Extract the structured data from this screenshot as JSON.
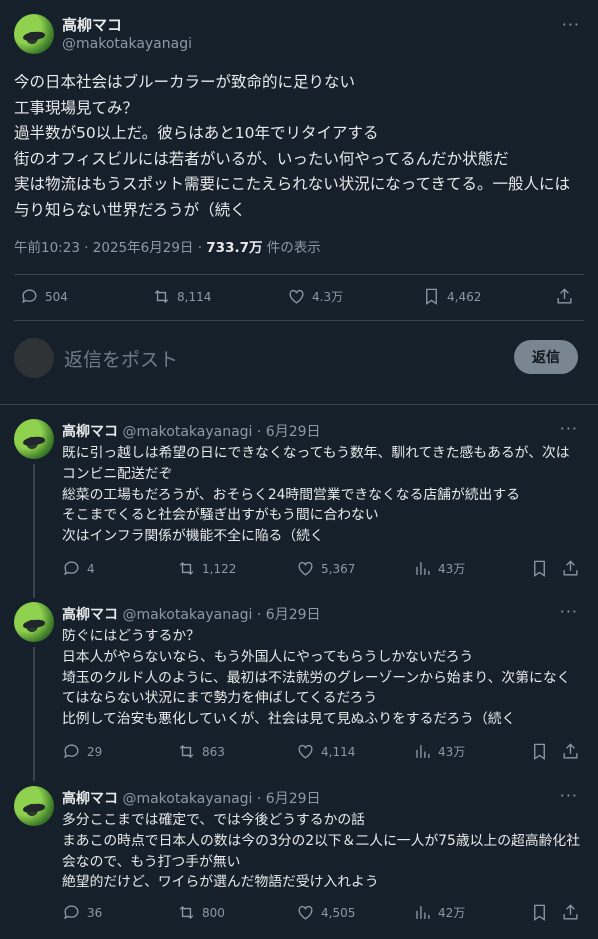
{
  "main_tweet": {
    "name": "高柳マコ",
    "handle": "@makotakayanagi",
    "body": "今の日本社会はブルーカラーが致命的に足りない\n工事現場見てみ？\n過半数が50以上だ。彼らはあと10年でリタイアする\n街のオフィスビルには若者がいるが、いったい何やってるんだか状態だ\n実は物流はもうスポット需要にこたえられない状況になってきてる。一般人には与り知らない世界だろうが（続く",
    "timestamp": "午前10:23 · 2025年6月29日 · ",
    "views_count": "733.7万",
    "views_label": " 件の表示",
    "replies": "504",
    "retweets": "8,114",
    "likes": "4.3万",
    "bookmarks": "4,462"
  },
  "reply_box": {
    "placeholder": "返信をポスト",
    "button_label": "返信"
  },
  "replies": [
    {
      "name": "高柳マコ",
      "meta": "@makotakayanagi · 6月29日",
      "body": "既に引っ越しは希望の日にできなくなってもう数年、馴れてきた感もあるが、次はコンビニ配送だぞ\n総菜の工場もだろうが、おそらく24時間営業できなくなる店舗が続出する\nそこまでくると社会が騒ぎ出すがもう間に合わない\n次はインフラ関係が機能不全に陥る（続く",
      "replies": "4",
      "retweets": "1,122",
      "likes": "5,367",
      "views": "43万"
    },
    {
      "name": "高柳マコ",
      "meta": "@makotakayanagi · 6月29日",
      "body": "防ぐにはどうするか？\n日本人がやらないなら、もう外国人にやってもらうしかないだろう\n埼玉のクルド人のように、最初は不法就労のグレーゾーンから始まり、次第になくてはならない状況にまで勢力を伸ばしてくるだろう\n比例して治安も悪化していくが、社会は見て見ぬふりをするだろう（続く",
      "replies": "29",
      "retweets": "863",
      "likes": "4,114",
      "views": "43万"
    },
    {
      "name": "高柳マコ",
      "meta": "@makotakayanagi · 6月29日",
      "body": "多分ここまでは確定で、では今後どうするかの話\nまあこの時点で日本人の数は今の3分の2以下＆二人に一人が75歳以上の超高齢化社会なので、もう打つ手が無い\n絶望的だけど、ワイらが選んだ物語だ受け入れよう",
      "replies": "36",
      "retweets": "800",
      "likes": "4,505",
      "views": "42万"
    }
  ],
  "more_glyph": "···"
}
